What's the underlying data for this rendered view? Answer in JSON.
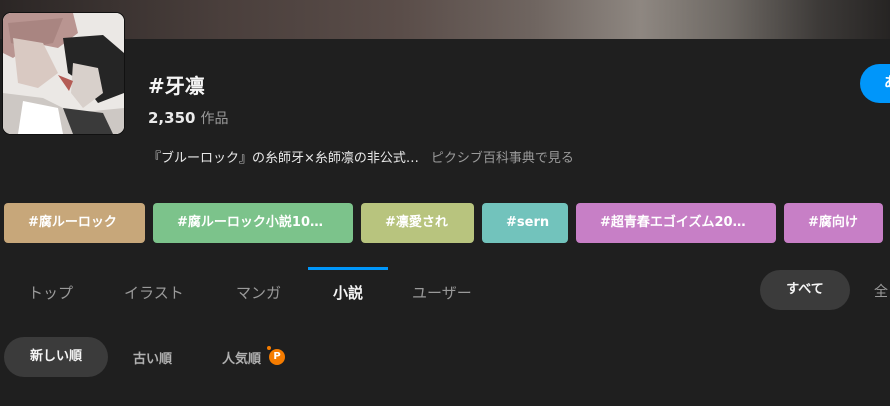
{
  "tag": {
    "title": "#牙凛",
    "work_count": "2,350",
    "work_unit": "作品",
    "description": "『ブルーロック』の糸師牙×糸師凛の非公式…",
    "encyclopedia_link": "ピクシブ百科事典で見る",
    "follow_label": "あ"
  },
  "related_tags": [
    {
      "label": "#腐ルーロック",
      "color": "#c7a77a"
    },
    {
      "label": "#腐ルーロック小説10…",
      "color": "#7cc38b"
    },
    {
      "label": "#凛愛され",
      "color": "#b8c47e"
    },
    {
      "label": "#sern",
      "color": "#72c3bc"
    },
    {
      "label": "#超青春エゴイズム20…",
      "color": "#c77fc6"
    },
    {
      "label": "#腐向け",
      "color": "#c77fc6"
    }
  ],
  "tabs": [
    {
      "label": "トップ"
    },
    {
      "label": "イラスト"
    },
    {
      "label": "マンガ"
    },
    {
      "label": "小説",
      "active": true
    },
    {
      "label": "ユーザー"
    }
  ],
  "filter": {
    "all_label": "すべて",
    "right_cut_label": "全"
  },
  "sort": {
    "newest": "新しい順",
    "oldest": "古い順",
    "popular": "人気順",
    "premium_icon": "premium-badge-icon",
    "premium_glyph": "P"
  },
  "colors": {
    "accent": "#0096fa",
    "background": "#1f1f1f",
    "premium": "#f57c00"
  }
}
